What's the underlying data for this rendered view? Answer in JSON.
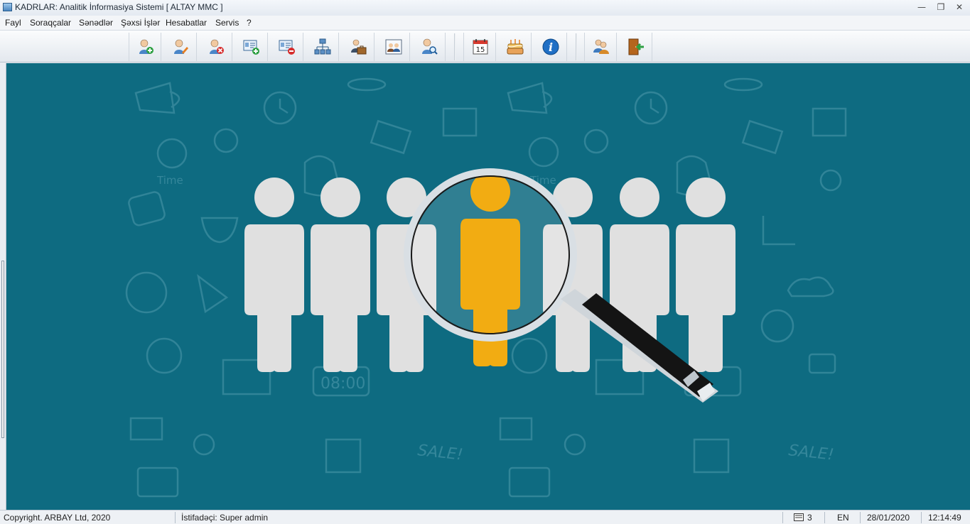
{
  "window": {
    "title": "KADRLAR: Analitik İnformasiya Sistemi [ ALTAY MMC ]",
    "minimize_glyph": "—",
    "restore_glyph": "❐",
    "close_glyph": "✕"
  },
  "menu": [
    {
      "label": "Fayl"
    },
    {
      "label": "Soraqçalar"
    },
    {
      "label": "Sənədlər"
    },
    {
      "label": "Şəxsi İşlər"
    },
    {
      "label": "Hesabatlar"
    },
    {
      "label": "Servis"
    },
    {
      "label": "?"
    }
  ],
  "toolbar": {
    "buttons": [
      {
        "icon": "add-employee-icon"
      },
      {
        "icon": "edit-employee-icon"
      },
      {
        "icon": "delete-employee-icon"
      },
      {
        "icon": "add-card-icon"
      },
      {
        "icon": "remove-card-icon"
      },
      {
        "icon": "structure-icon"
      },
      {
        "icon": "staff-briefcase-icon"
      },
      {
        "icon": "staff-list-icon"
      },
      {
        "icon": "search-employee-icon"
      },
      {
        "icon": "calendar-icon"
      },
      {
        "icon": "birthday-cake-icon"
      },
      {
        "icon": "info-icon"
      },
      {
        "icon": "users-keys-icon"
      },
      {
        "icon": "exit-door-icon"
      }
    ],
    "calendar_day": "15",
    "info_glyph": "i"
  },
  "banner": {
    "background_color": "#0e6b81",
    "figure_color": "#e0e0e0",
    "highlight_color": "#f2ac12",
    "doodles": [
      "Time",
      "08:00",
      "SALE!"
    ]
  },
  "statusbar": {
    "copyright": "Copyright. ARBAY Ltd, 2020",
    "user": "İstifadəçi: Super admin",
    "window_count": "3",
    "language": "EN",
    "date": "28/01/2020",
    "time": "12:14:49"
  }
}
